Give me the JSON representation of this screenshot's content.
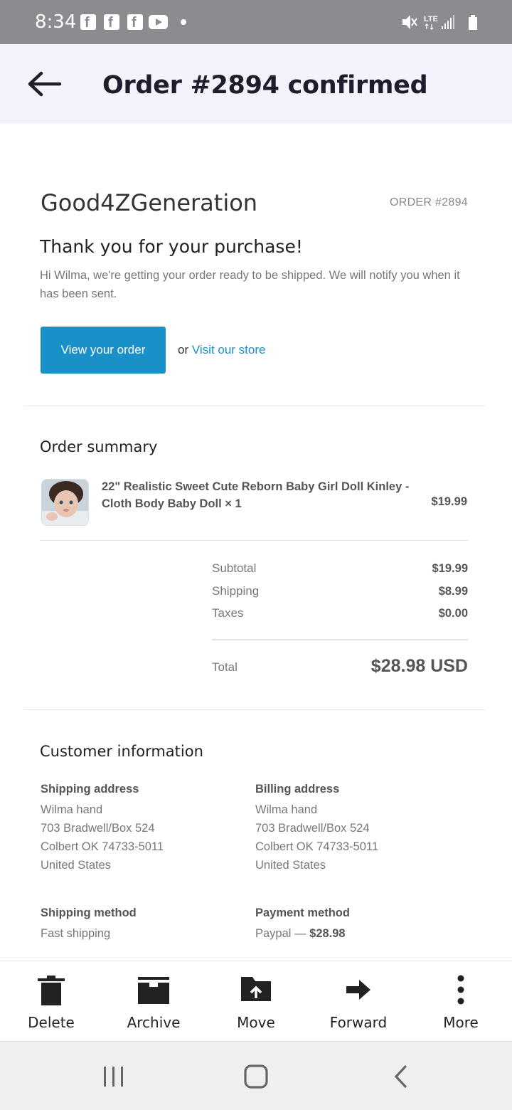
{
  "status_bar": {
    "time": "8:34",
    "notification_icons": [
      "facebook-icon",
      "facebook-icon",
      "facebook-icon",
      "youtube-icon",
      "dot-icon"
    ],
    "network": "LTE"
  },
  "app_bar": {
    "title": "Order #2894 confirmed"
  },
  "email": {
    "shop_name": "Good4ZGeneration",
    "order_number": "ORDER #2894",
    "thanks_heading": "Thank you for your purchase!",
    "intro_text": "Hi Wilma, we're getting your order ready to be shipped. We will notify you when it has been sent.",
    "view_order_button": "View your order",
    "or_text": "or",
    "store_link": "Visit our store",
    "accent_color": "#1a90c8"
  },
  "order_summary": {
    "title": "Order summary",
    "item": {
      "name": "22\" Realistic Sweet Cute Reborn Baby Girl Doll Kinley - Cloth Body Baby Doll × 1",
      "price": "$19.99"
    },
    "subtotal_label": "Subtotal",
    "subtotal_value": "$19.99",
    "shipping_label": "Shipping",
    "shipping_value": "$8.99",
    "taxes_label": "Taxes",
    "taxes_value": "$0.00",
    "total_label": "Total",
    "total_value": "$28.98 USD"
  },
  "customer_info": {
    "title": "Customer information",
    "shipping_address": {
      "heading": "Shipping address",
      "name": "Wilma hand",
      "line1": "703 Bradwell/Box 524",
      "line2": "Colbert OK 74733-5011",
      "country": "United States"
    },
    "billing_address": {
      "heading": "Billing address",
      "name": "Wilma hand",
      "line1": "703 Bradwell/Box 524",
      "line2": "Colbert OK 74733-5011",
      "country": "United States"
    },
    "shipping_method": {
      "heading": "Shipping method",
      "value": "Fast shipping"
    },
    "payment_method": {
      "heading": "Payment method",
      "provider": "Paypal —",
      "amount": "$28.98"
    }
  },
  "actions": {
    "delete": "Delete",
    "archive": "Archive",
    "move": "Move",
    "forward": "Forward",
    "more": "More"
  }
}
